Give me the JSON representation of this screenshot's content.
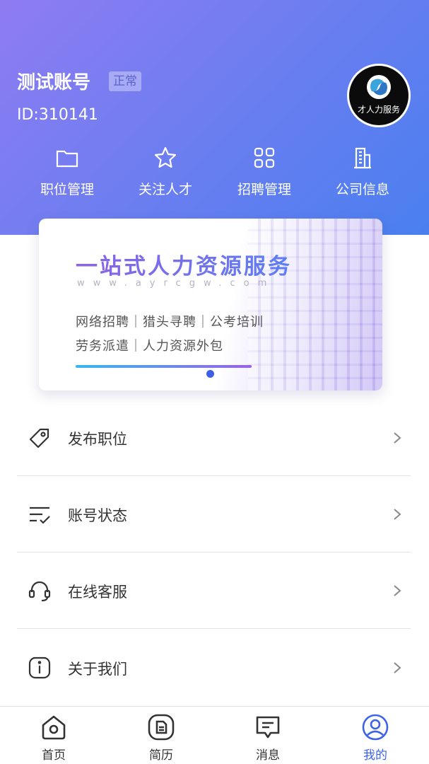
{
  "profile": {
    "name": "测试账号",
    "status": "正常",
    "id_label": "ID:310141",
    "avatar_text": "才人力服务"
  },
  "quick_actions": [
    {
      "label": "职位管理",
      "icon": "folder-icon"
    },
    {
      "label": "关注人才",
      "icon": "star-icon"
    },
    {
      "label": "招聘管理",
      "icon": "grid-icon"
    },
    {
      "label": "公司信息",
      "icon": "building-icon"
    }
  ],
  "banner": {
    "title": "一站式人力资源服务",
    "url": "www.ayrcgw.com",
    "line1": "网络招聘｜猎头寻聘｜公考培训",
    "line2": "劳务派遣｜人力资源外包"
  },
  "menu": [
    {
      "label": "发布职位",
      "icon": "tag-icon"
    },
    {
      "label": "账号状态",
      "icon": "checklist-icon"
    },
    {
      "label": "在线客服",
      "icon": "headset-icon"
    },
    {
      "label": "关于我们",
      "icon": "info-icon"
    }
  ],
  "tabbar": {
    "items": [
      {
        "label": "首页",
        "icon": "home-icon"
      },
      {
        "label": "简历",
        "icon": "resume-icon"
      },
      {
        "label": "消息",
        "icon": "message-icon"
      },
      {
        "label": "我的",
        "icon": "user-icon"
      }
    ],
    "active_index": 3
  },
  "colors": {
    "header_gradient_start": "#8f7bf2",
    "header_gradient_end": "#4a7ff0",
    "active_tab": "#3e63e8",
    "text_primary": "#333333"
  }
}
